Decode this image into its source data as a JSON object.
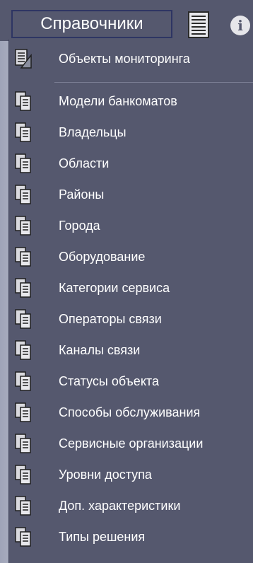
{
  "menubar": {
    "title": "Справочники",
    "list_icon": "list-document-icon",
    "info_icon_glyph": "i"
  },
  "dropdown": {
    "first_item": {
      "label": "Объекты мониторинга",
      "icon": "monitoring-objects-icon"
    },
    "items": [
      {
        "label": "Модели банкоматов",
        "icon": "reference-book-icon"
      },
      {
        "label": "Владельцы",
        "icon": "reference-book-icon"
      },
      {
        "label": "Области",
        "icon": "reference-book-icon"
      },
      {
        "label": "Районы",
        "icon": "reference-book-icon"
      },
      {
        "label": "Города",
        "icon": "reference-book-icon"
      },
      {
        "label": "Оборудование",
        "icon": "reference-book-icon"
      },
      {
        "label": "Категории сервиса",
        "icon": "reference-book-icon"
      },
      {
        "label": "Операторы связи",
        "icon": "reference-book-icon"
      },
      {
        "label": "Каналы связи",
        "icon": "reference-book-icon"
      },
      {
        "label": "Статусы объекта",
        "icon": "reference-book-icon"
      },
      {
        "label": "Способы обслуживания",
        "icon": "reference-book-icon"
      },
      {
        "label": "Сервисные организации",
        "icon": "reference-book-icon"
      },
      {
        "label": "Уровни доступа",
        "icon": "reference-book-icon"
      },
      {
        "label": "Доп. характеристики",
        "icon": "reference-book-icon"
      },
      {
        "label": "Типы решения",
        "icon": "reference-book-icon"
      }
    ]
  },
  "colors": {
    "menu_background": "#55586e",
    "title_border": "#2e3563",
    "text": "#ffffff"
  }
}
